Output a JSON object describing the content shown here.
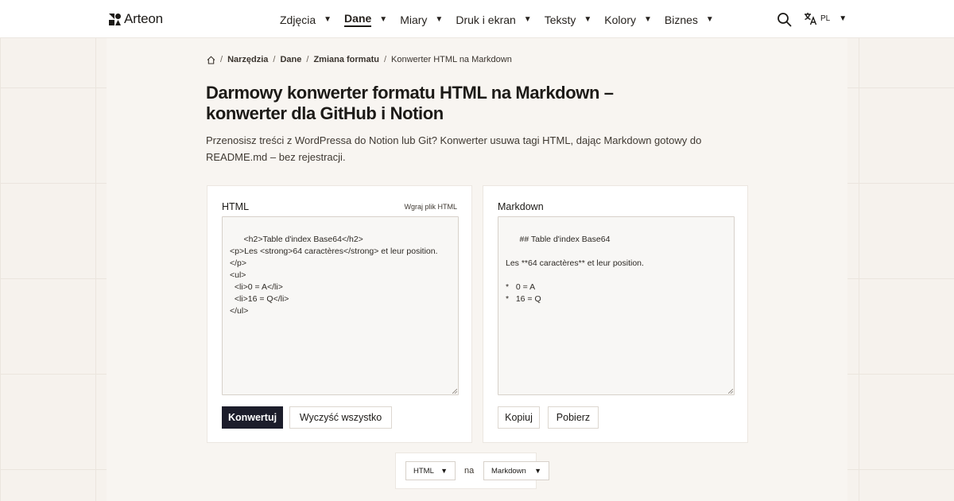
{
  "header": {
    "logo_text": "Arteon",
    "nav": [
      {
        "label": "Zdjęcia",
        "active": false
      },
      {
        "label": "Dane",
        "active": true
      },
      {
        "label": "Miary",
        "active": false
      },
      {
        "label": "Druk i ekran",
        "active": false
      },
      {
        "label": "Teksty",
        "active": false
      },
      {
        "label": "Kolory",
        "active": false
      },
      {
        "label": "Biznes",
        "active": false
      }
    ],
    "lang_code": "PL",
    "icons": [
      "search-icon",
      "translate-icon",
      "chevron-down-icon"
    ]
  },
  "breadcrumb": {
    "items": [
      "Narzędzia",
      "Dane",
      "Zmiana formatu"
    ],
    "current": "Konwerter HTML na Markdown"
  },
  "page": {
    "title": "Darmowy konwerter formatu HTML na Markdown – konwerter dla GitHub i Notion",
    "description": "Przenosisz treści z WordPressa do Notion lub Git? Konwerter usuwa tagi HTML, dając Markdown gotowy do README.md – bez rejestracji."
  },
  "input_panel": {
    "title": "HTML",
    "upload_label": "Wgraj plik HTML",
    "value": "<h2>Table d'index Base64</h2>\n<p>Les <strong>64 caractères</strong> et leur position.</p>\n<ul>\n  <li>0 = A</li>\n  <li>16 = Q</li>\n</ul>",
    "convert_label": "Konwertuj",
    "clear_label": "Wyczyść wszystko"
  },
  "output_panel": {
    "title": "Markdown",
    "value": "## Table d'index Base64\n\nLes **64 caractères** et leur position.\n\n*   0 = A\n*   16 = Q",
    "copy_label": "Kopiuj",
    "download_label": "Pobierz"
  },
  "format_switch": {
    "from": "HTML",
    "separator": "na",
    "to": "Markdown"
  },
  "colors": {
    "primary_button": "#1c1d2b",
    "background": "#f6f2ed",
    "panel": "#f8f5f1"
  }
}
